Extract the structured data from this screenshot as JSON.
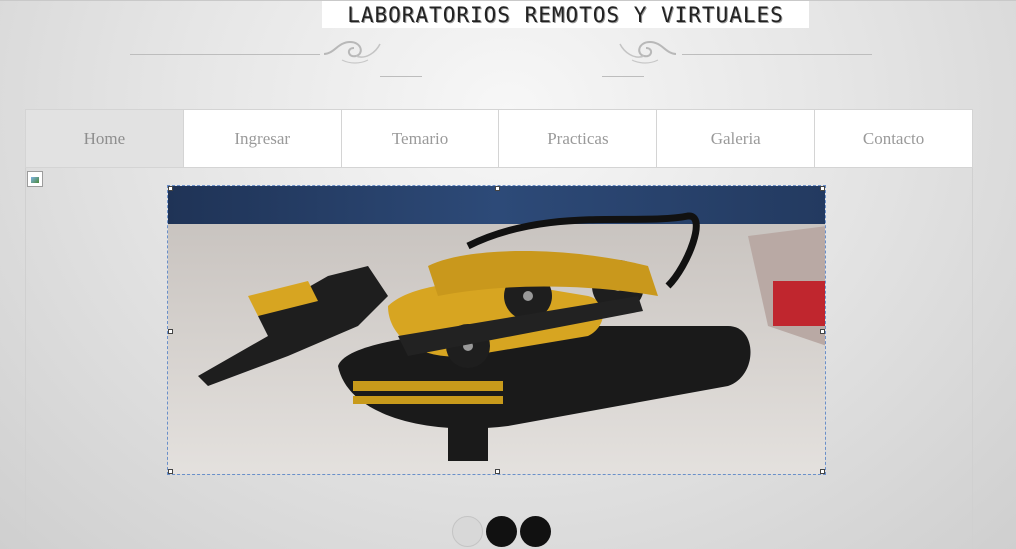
{
  "header": {
    "title": "LABORATORIOS REMOTOS Y VIRTUALES"
  },
  "nav": {
    "items": [
      {
        "label": "Home",
        "active": true
      },
      {
        "label": "Ingresar",
        "active": false
      },
      {
        "label": "Temario",
        "active": false
      },
      {
        "label": "Practicas",
        "active": false
      },
      {
        "label": "Galeria",
        "active": false
      },
      {
        "label": "Contacto",
        "active": false
      }
    ]
  },
  "slider": {
    "image_subject": "robotic arm kit (black and yellow) on a white table",
    "slide_count": 3,
    "active_slide": 1
  },
  "colors": {
    "nav_text": "#9a9a9a",
    "nav_active_bg": "#e2e2e2",
    "dot_inactive": "#111111",
    "dot_active": "#d8d8d8",
    "selection_border": "#6a8fc9"
  }
}
